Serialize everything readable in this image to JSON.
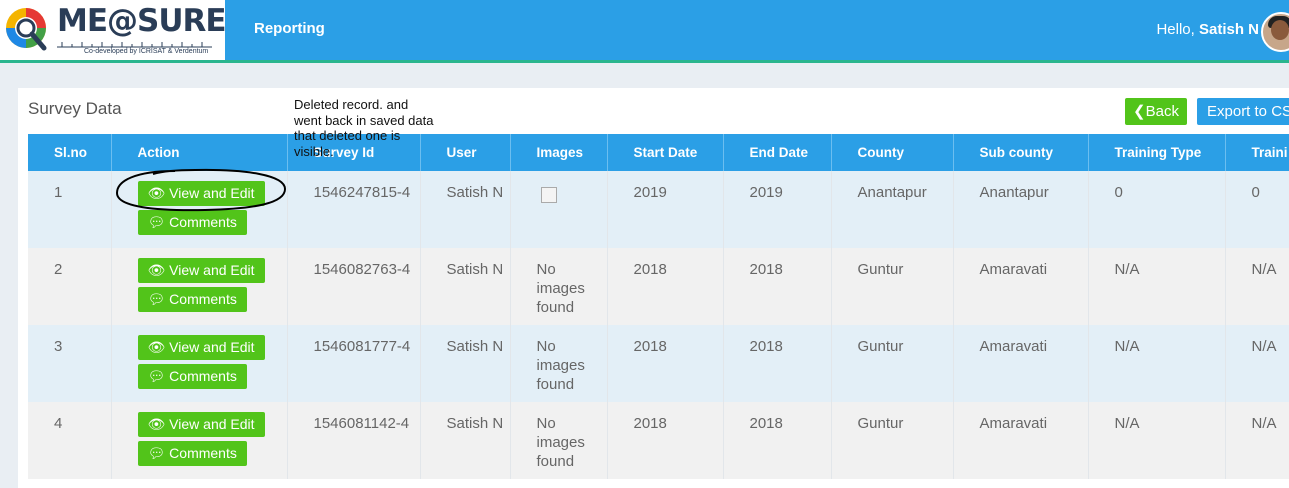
{
  "header": {
    "logo_text": "ME@SURE",
    "logo_subtitle": "Co-developed by ICRISAT & Verdentum",
    "nav_reporting": "Reporting",
    "greeting": "Hello,",
    "user_name": "Satish N",
    "colors": {
      "bar": "#2b9fe6",
      "accent_strip": "#2ab58e"
    }
  },
  "card": {
    "title": "Survey Data",
    "back_label": "Back",
    "export_label": "Export to CSV"
  },
  "table": {
    "headers": [
      "Sl.no",
      "Action",
      "Survey Id",
      "User",
      "Images",
      "Start Date",
      "End Date",
      "County",
      "Sub county",
      "Training Type",
      "Traini"
    ],
    "view_label": "View and Edit",
    "comments_label": "Comments",
    "rows": [
      {
        "slno": "1",
        "survey_id": "1546247815-4",
        "user": "Satish N",
        "images": "",
        "start": "2019",
        "end": "2019",
        "county": "Anantapur",
        "subcounty": "Anantapur",
        "training_type": "0",
        "training": "0"
      },
      {
        "slno": "2",
        "survey_id": "1546082763-4",
        "user": "Satish N",
        "images": "No images found",
        "start": "2018",
        "end": "2018",
        "county": "Guntur",
        "subcounty": "Amaravati",
        "training_type": "N/A",
        "training": "N/A"
      },
      {
        "slno": "3",
        "survey_id": "1546081777-4",
        "user": "Satish N",
        "images": "No images found",
        "start": "2018",
        "end": "2018",
        "county": "Guntur",
        "subcounty": "Amaravati",
        "training_type": "N/A",
        "training": "N/A"
      },
      {
        "slno": "4",
        "survey_id": "1546081142-4",
        "user": "Satish N",
        "images": "No images found",
        "start": "2018",
        "end": "2018",
        "county": "Guntur",
        "subcounty": "Amaravati",
        "training_type": "N/A",
        "training": "N/A"
      }
    ]
  },
  "annotation": {
    "note": "Deleted record. and went back in saved data that deleted one is visible."
  }
}
